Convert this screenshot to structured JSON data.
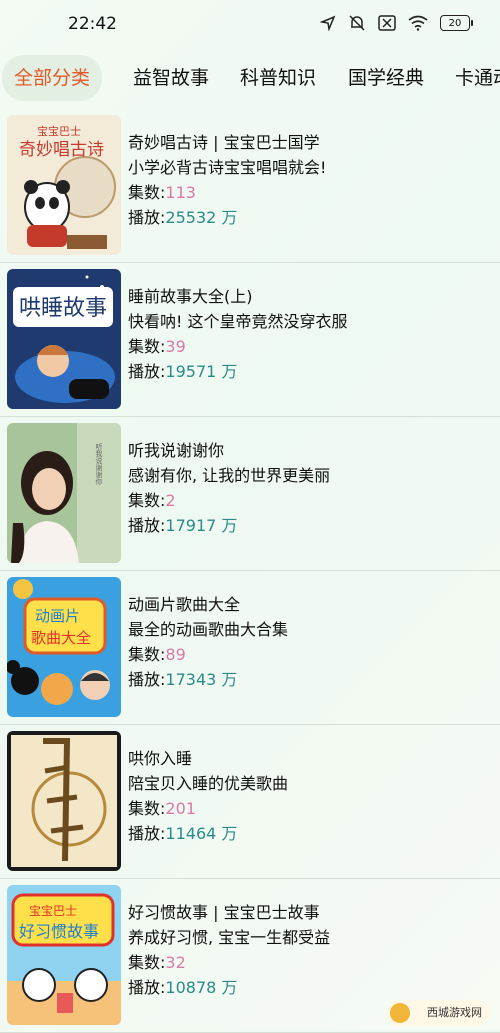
{
  "status": {
    "time": "22:42",
    "battery": "20"
  },
  "tabs": [
    "全部分类",
    "益智故事",
    "科普知识",
    "国学经典",
    "卡通动"
  ],
  "items": [
    {
      "title": "奇妙唱古诗 | 宝宝巴士国学",
      "desc": "小学必背古诗宝宝唱唱就会!",
      "count_label": "集数:",
      "count": "113",
      "play_label": "播放:",
      "plays": "25532 万",
      "cover_text": "宝宝巴士 奇妙唱古诗"
    },
    {
      "title": "睡前故事大全(上)",
      "desc": "快看呐! 这个皇帝竟然没穿衣服",
      "count_label": "集数:",
      "count": "39",
      "play_label": "播放:",
      "plays": "19571 万",
      "cover_text": "哄睡故事"
    },
    {
      "title": "听我说谢谢你",
      "desc": "感谢有你, 让我的世界更美丽",
      "count_label": "集数:",
      "count": "2",
      "play_label": "播放:",
      "plays": "17917 万",
      "cover_text": ""
    },
    {
      "title": "动画片歌曲大全",
      "desc": "最全的动画歌曲大合集",
      "count_label": "集数:",
      "count": "89",
      "play_label": "播放:",
      "plays": "17343 万",
      "cover_text": "动画片 歌曲大全"
    },
    {
      "title": "哄你入睡",
      "desc": "陪宝贝入睡的优美歌曲",
      "count_label": "集数:",
      "count": "201",
      "play_label": "播放:",
      "plays": "11464 万",
      "cover_text": ""
    },
    {
      "title": "好习惯故事 | 宝宝巴士故事",
      "desc": "养成好习惯, 宝宝一生都受益",
      "count_label": "集数:",
      "count": "32",
      "play_label": "播放:",
      "plays": "10878 万",
      "cover_text": "宝宝巴士 好习惯故事"
    }
  ],
  "watermark": "西城游戏网"
}
